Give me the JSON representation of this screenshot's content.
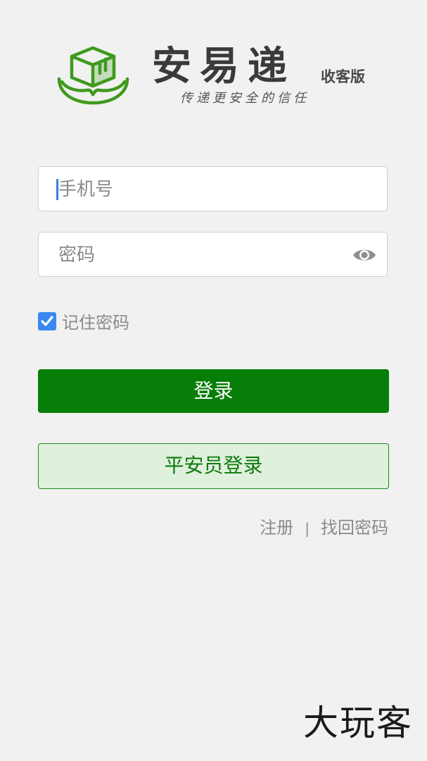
{
  "brand": {
    "name": "安易递",
    "edition": "收客版",
    "slogan": "传递更安全的信任"
  },
  "form": {
    "phone_placeholder": "手机号",
    "password_placeholder": "密码",
    "remember_label": "记住密码",
    "remember_checked": true
  },
  "buttons": {
    "login": "登录",
    "agent_login": "平安员登录"
  },
  "links": {
    "register": "注册",
    "separator": "|",
    "forgot": "找回密码"
  },
  "watermark": "大玩客",
  "colors": {
    "primary": "#077e07",
    "secondary_bg": "#dff0dc",
    "checkbox": "#3b88f0",
    "logo": "#3f9a1e"
  },
  "icons": {
    "logo": "box-hands-logo",
    "eye": "eye-icon",
    "check": "check-icon"
  }
}
